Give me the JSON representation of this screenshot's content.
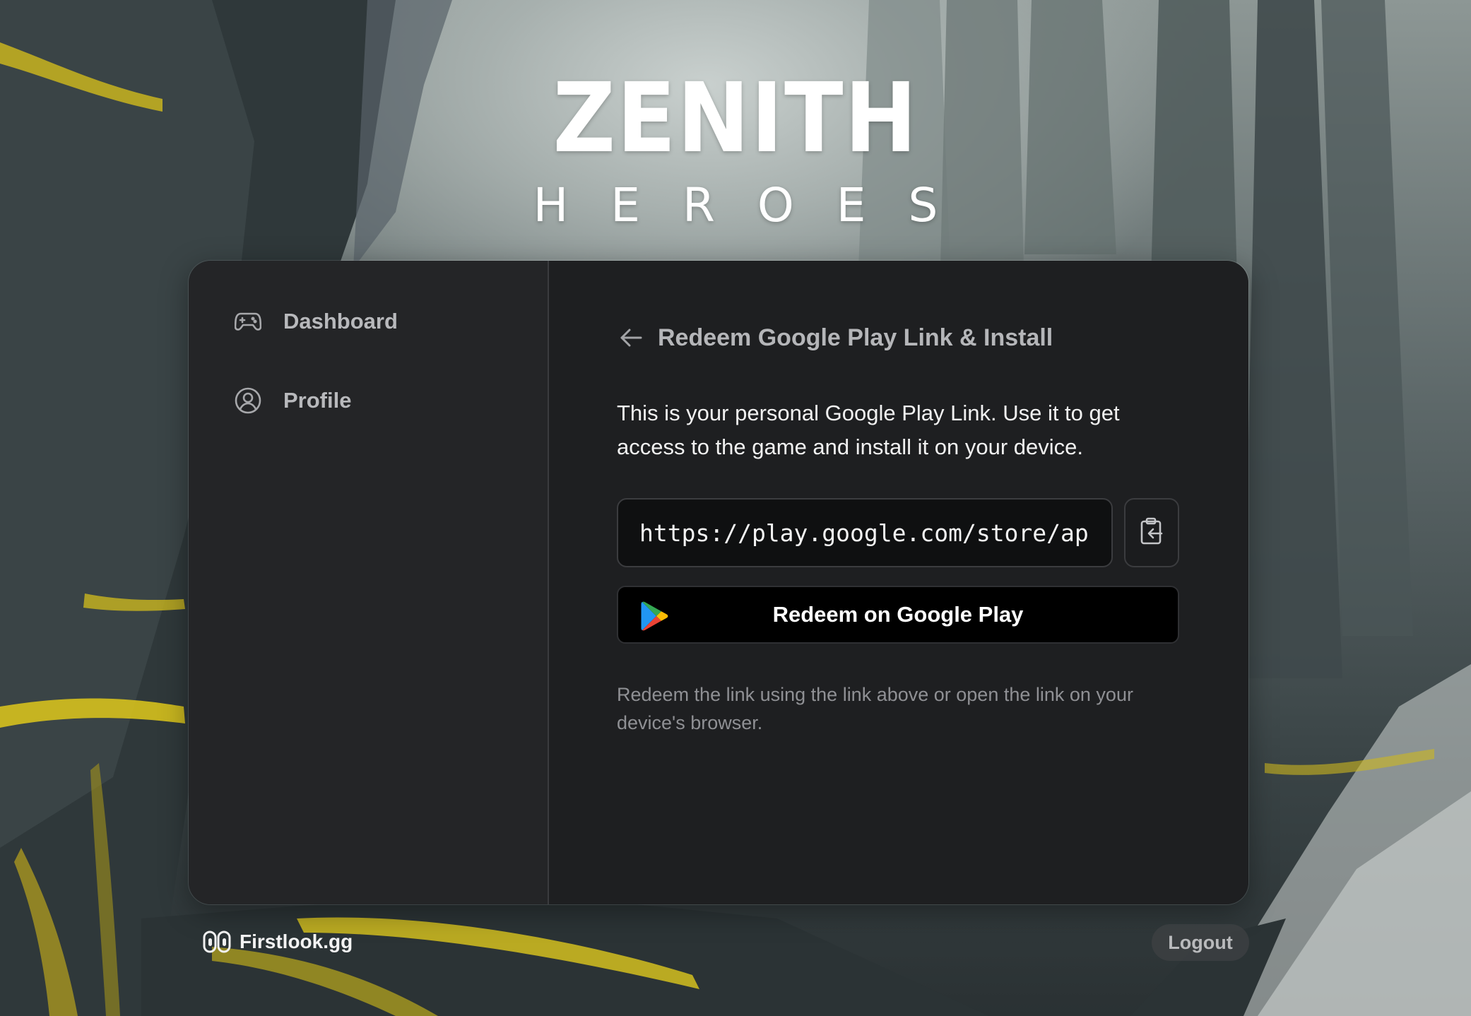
{
  "logo": {
    "title": "ZENITH",
    "subtitle": "HEROES"
  },
  "sidebar": {
    "items": [
      {
        "label": "Dashboard",
        "icon": "gamepad-icon"
      },
      {
        "label": "Profile",
        "icon": "user-circle-icon"
      }
    ]
  },
  "main": {
    "title": "Redeem Google Play Link & Install",
    "description": "This is your personal Google Play Link. Use it to get access to the game and install it on your device.",
    "link_value": "https://play.google.com/store/apps/details",
    "copy_icon": "clipboard-icon",
    "redeem_label": "Redeem on Google Play",
    "help_text": "Redeem the link using the link above or open the link on your device's browser."
  },
  "footer": {
    "brand": "Firstlook.gg",
    "logout_label": "Logout"
  },
  "colors": {
    "card_sidebar": "#242527",
    "card_main": "#1e1f21",
    "accent_yellow": "#d8c21e"
  }
}
